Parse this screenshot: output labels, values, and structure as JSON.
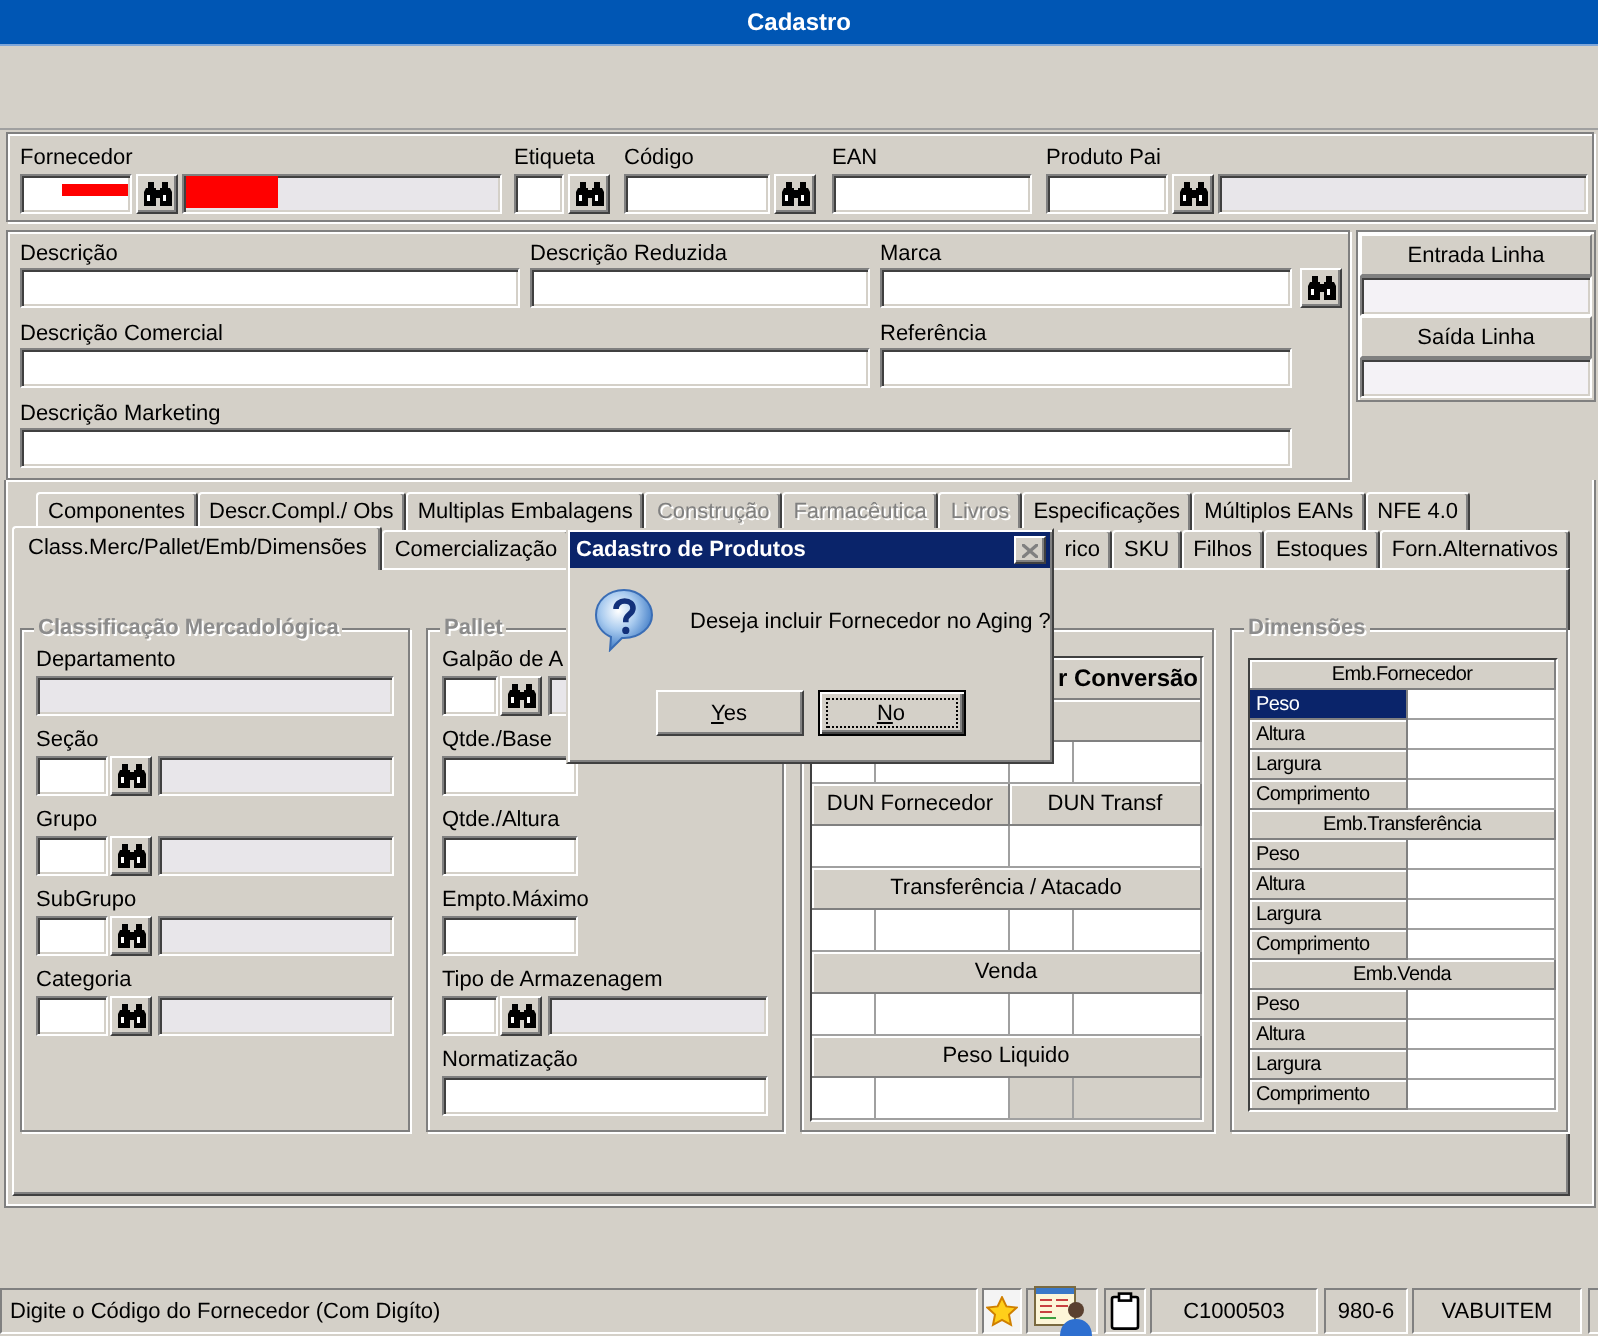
{
  "window": {
    "title": "Cadastro"
  },
  "supplier_fields": [
    {
      "label": "Fornecedor",
      "lookup": true,
      "redacted": true,
      "description": {
        "redacted": true
      }
    },
    {
      "label": "Etiqueta",
      "lookup": true,
      "redacted": false
    },
    {
      "label": "Código",
      "lookup": true,
      "redacted": false
    },
    {
      "label": "EAN",
      "lookup": false,
      "redacted": false
    },
    {
      "label": "Produto Pai",
      "lookup": true,
      "redacted": false,
      "description": {
        "redacted": false
      }
    }
  ],
  "product_rows": [
    {
      "fields": [
        {
          "label": "Descrição",
          "lookup": false
        },
        {
          "label": "Descrição Reduzida",
          "lookup": false
        },
        {
          "label": "Marca",
          "lookup": true
        }
      ]
    },
    {
      "fields": [
        {
          "label": "Descrição Comercial",
          "lookup": false
        },
        {
          "label": "Referência",
          "lookup": false
        }
      ]
    },
    {
      "fields": [
        {
          "label": "Descrição Marketing",
          "lookup": false
        }
      ]
    }
  ],
  "line_panel": [
    {
      "label": "Entrada Linha"
    },
    {
      "label": "Saída Linha"
    }
  ],
  "tab_rows": [
    {
      "tabs": [
        {
          "label": "Componentes",
          "selected": false,
          "disabled": false
        },
        {
          "label": "Descr.Compl./ Obs",
          "selected": false,
          "disabled": false
        },
        {
          "label": "Multiplas Embalagens",
          "selected": false,
          "disabled": false
        },
        {
          "label": "Construção",
          "selected": false,
          "disabled": true
        },
        {
          "label": "Farmacêutica",
          "selected": false,
          "disabled": true
        },
        {
          "label": "Livros",
          "selected": false,
          "disabled": true
        },
        {
          "label": "Especificações",
          "selected": false,
          "disabled": false
        },
        {
          "label": "Múltiplos EANs",
          "selected": false,
          "disabled": false
        },
        {
          "label": "NFE 4.0",
          "selected": false,
          "disabled": false
        }
      ]
    },
    {
      "tabs": [
        {
          "label": "Class.Merc/Pallet/Emb/Dimensões",
          "selected": true,
          "disabled": false
        },
        {
          "label": "Comercialização",
          "selected": false,
          "disabled": false
        },
        {
          "label": "rico",
          "selected": false,
          "disabled": false
        },
        {
          "label": "SKU",
          "selected": false,
          "disabled": false
        },
        {
          "label": "Filhos",
          "selected": false,
          "disabled": false
        },
        {
          "label": "Estoques",
          "selected": false,
          "disabled": false
        },
        {
          "label": "Forn.Alternativos",
          "selected": false,
          "disabled": false
        }
      ]
    }
  ],
  "classification": {
    "title": "Classificação Mercadológica",
    "fields": [
      {
        "label": "Departamento",
        "kind": "readonly"
      },
      {
        "label": "Seção",
        "kind": "lookup"
      },
      {
        "label": "Grupo",
        "kind": "lookup"
      },
      {
        "label": "SubGrupo",
        "kind": "lookup"
      },
      {
        "label": "Categoria",
        "kind": "lookup"
      }
    ]
  },
  "pallet": {
    "title": "Pallet",
    "fields": [
      {
        "label": "Galpão de A",
        "kind": "lookup"
      },
      {
        "label": "Qtde./Base",
        "kind": "short"
      },
      {
        "label": "Qtde./Altura",
        "kind": "short"
      },
      {
        "label": "Empto.Máximo",
        "kind": "short"
      },
      {
        "label": "Tipo de Armazenagem",
        "kind": "lookup"
      },
      {
        "label": "Normatização",
        "kind": "wide"
      }
    ]
  },
  "conversion": {
    "rows": [
      {
        "kind": "title",
        "text": "r Conversão"
      },
      {
        "kind": "header"
      },
      {
        "kind": "inputs",
        "cells": [
          {
            "disabled": false
          },
          {
            "disabled": false
          },
          {
            "disabled": false
          },
          {
            "disabled": false
          }
        ]
      },
      {
        "kind": "header",
        "labels": [
          "DUN Fornecedor",
          "DUN Transf"
        ]
      },
      {
        "kind": "inputs",
        "cells": [
          {
            "disabled": false
          },
          {
            "disabled": false
          }
        ]
      },
      {
        "kind": "header",
        "labels": [
          "Transferência / Atacado"
        ]
      },
      {
        "kind": "inputs",
        "cells": [
          {
            "disabled": false
          },
          {
            "disabled": false
          },
          {
            "disabled": false
          },
          {
            "disabled": false
          }
        ]
      },
      {
        "kind": "header",
        "labels": [
          "Venda"
        ]
      },
      {
        "kind": "inputs",
        "cells": [
          {
            "disabled": false
          },
          {
            "disabled": false
          },
          {
            "disabled": false
          },
          {
            "disabled": false
          }
        ]
      },
      {
        "kind": "header",
        "labels": [
          "Peso Liquido"
        ]
      },
      {
        "kind": "inputs",
        "cells": [
          {
            "disabled": false
          },
          {
            "disabled": false
          },
          {
            "disabled": true
          },
          {
            "disabled": true
          }
        ]
      }
    ]
  },
  "dimensions": {
    "title": "Dimensões",
    "sections": [
      {
        "title": "Emb.Fornecedor",
        "rows": [
          {
            "label": "Peso",
            "selected": true
          },
          {
            "label": "Altura",
            "selected": false
          },
          {
            "label": "Largura",
            "selected": false
          },
          {
            "label": "Comprimento",
            "selected": false
          }
        ]
      },
      {
        "title": "Emb.Transferência",
        "rows": [
          {
            "label": "Peso",
            "selected": false
          },
          {
            "label": "Altura",
            "selected": false
          },
          {
            "label": "Largura",
            "selected": false
          },
          {
            "label": "Comprimento",
            "selected": false
          }
        ]
      },
      {
        "title": "Emb.Venda",
        "rows": [
          {
            "label": "Peso",
            "selected": false
          },
          {
            "label": "Altura",
            "selected": false
          },
          {
            "label": "Largura",
            "selected": false
          },
          {
            "label": "Comprimento",
            "selected": false
          }
        ]
      }
    ]
  },
  "dialog": {
    "title": "Cadastro de Produtos",
    "close_disabled": true,
    "message": "Deseja incluir Fornecedor no Aging ?",
    "buttons": [
      {
        "label": "Yes",
        "default": false
      },
      {
        "label": "No",
        "default": true
      }
    ]
  },
  "status_bar": {
    "message": "Digite o Código do Fornecedor (Com Digíto)",
    "panels": [
      "C1000503",
      "980-6",
      "VABUITEM"
    ]
  }
}
